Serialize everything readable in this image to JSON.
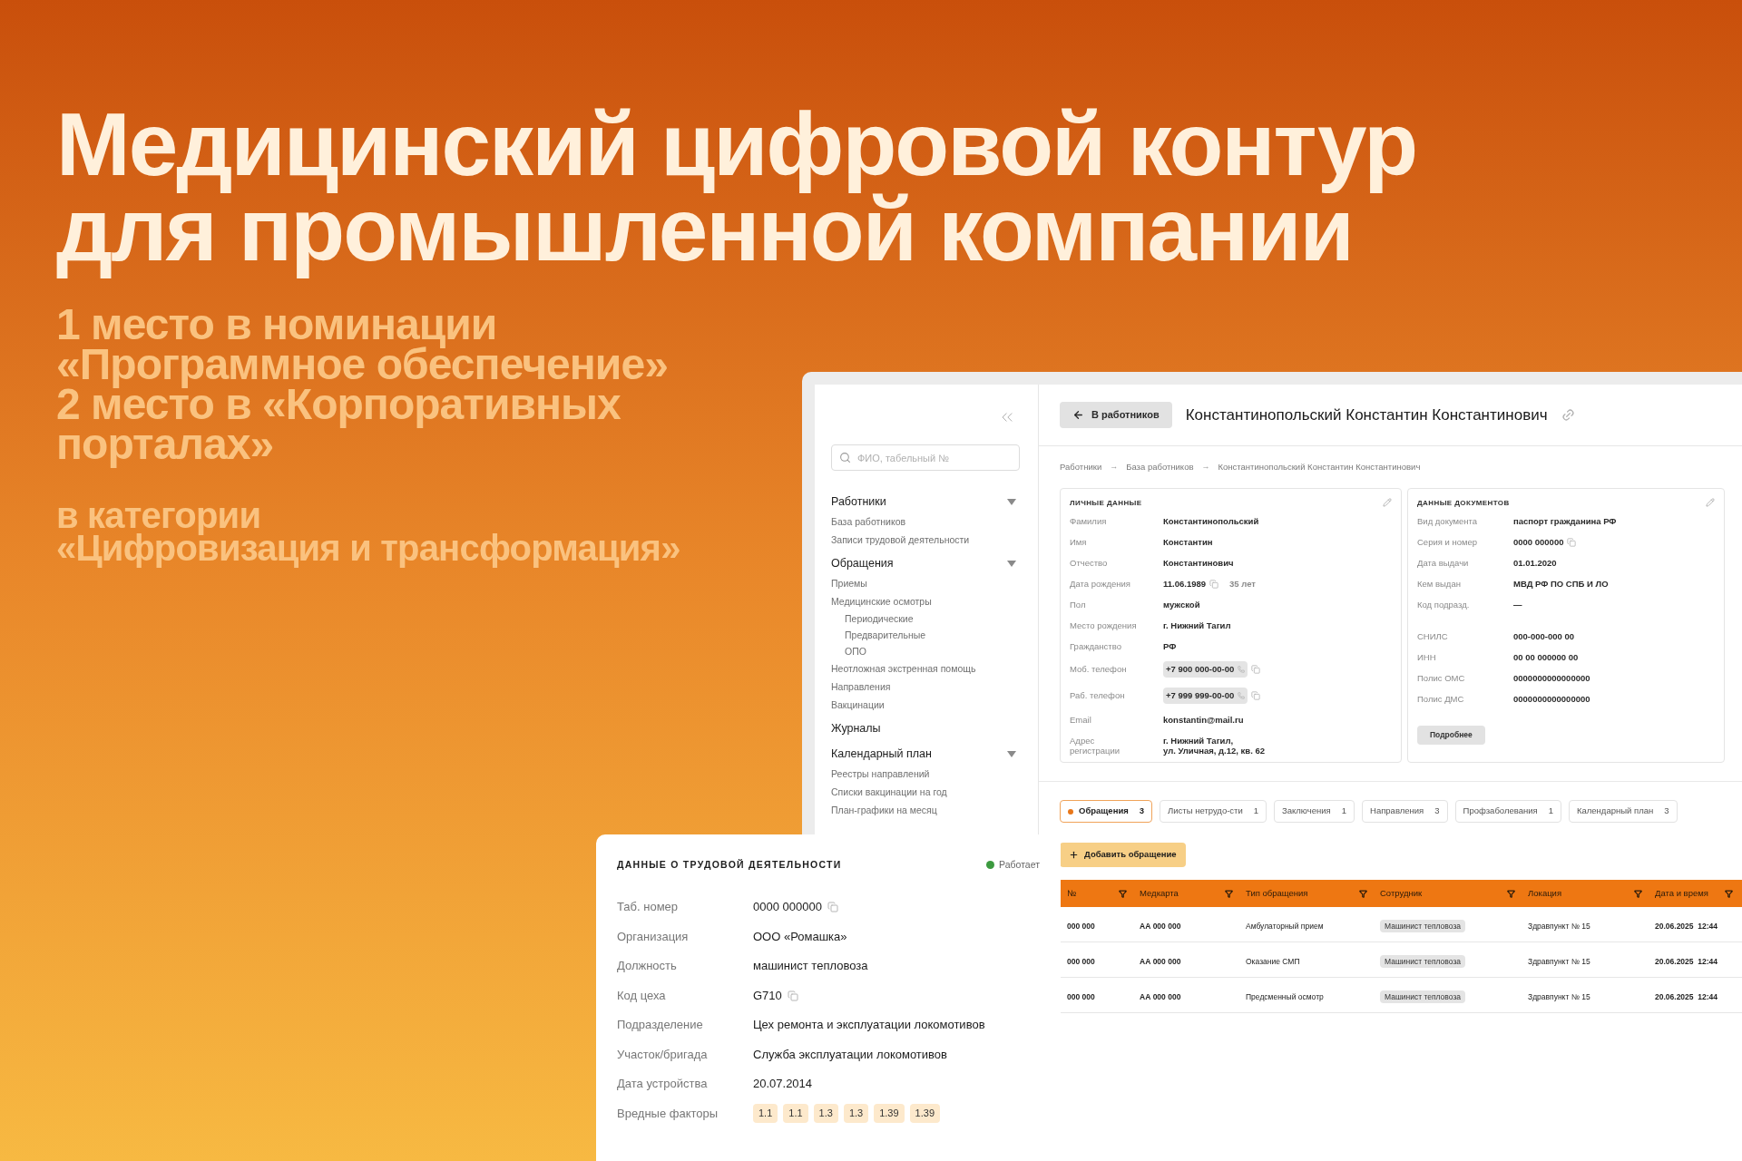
{
  "headline": [
    "Медицинский цифровой контур",
    "для промышленной компании"
  ],
  "awards": [
    "1 место в номинации",
    "«Программное обеспечение»",
    "2 место в «Корпоративных",
    "порталах»"
  ],
  "category": [
    "в категории",
    "«Цифровизация и трансформация»"
  ],
  "sidebar": {
    "search_placeholder": "ФИО, табельный №",
    "sections": [
      {
        "title": "Работники",
        "kind": "group",
        "expanded": true,
        "items": [
          {
            "label": "База работников"
          },
          {
            "label": "Записи трудовой деятельности"
          }
        ]
      },
      {
        "title": "Обращения",
        "kind": "group",
        "expanded": true,
        "items": [
          {
            "label": "Приемы"
          },
          {
            "label": "Медицинские осмотры",
            "children": [
              {
                "label": "Периодические"
              },
              {
                "label": "Предварительные"
              },
              {
                "label": "ОПО"
              }
            ]
          },
          {
            "label": "Неотложная экстренная помощь"
          },
          {
            "label": "Направления"
          },
          {
            "label": "Вакцинации"
          }
        ]
      },
      {
        "title": "Журналы",
        "kind": "link"
      },
      {
        "title": "Календарный план",
        "kind": "group",
        "expanded": true,
        "items": [
          {
            "label": "Реестры направлений"
          },
          {
            "label": "Списки вакцинации на год"
          },
          {
            "label": "План-графики на месяц"
          }
        ]
      }
    ]
  },
  "header": {
    "back_button": "В работников",
    "title": "Константинопольский Константин Константинович"
  },
  "breadcrumbs": {
    "separator": "→",
    "items": [
      "Работники",
      "База работников",
      "Константинопольский Константин Константинович"
    ]
  },
  "personal_card": {
    "title": "ЛИЧНЫЕ ДАННЫЕ",
    "rows": [
      {
        "kind": "text",
        "label": "Фамилия",
        "value": "Константинопольский"
      },
      {
        "kind": "text",
        "label": "Имя",
        "value": "Константин"
      },
      {
        "kind": "text",
        "label": "Отчество",
        "value": "Константинович"
      },
      {
        "kind": "date",
        "label": "Дата рождения",
        "value": "11.06.1989",
        "extra": "35 лет"
      },
      {
        "kind": "text",
        "label": "Пол",
        "value": "мужской"
      },
      {
        "kind": "text",
        "label": "Место рождения",
        "value": "г. Нижний Тагил"
      },
      {
        "kind": "text",
        "label": "Гражданство",
        "value": "РФ"
      },
      {
        "kind": "phone",
        "label": "Моб. телефон",
        "value": "+7 900 000-00-00"
      },
      {
        "kind": "phone",
        "label": "Раб. телефон",
        "value": "+7 999 999-00-00"
      },
      {
        "kind": "text",
        "label": "Email",
        "value": "konstantin@mail.ru"
      },
      {
        "kind": "text",
        "label": "Адрес\nрегистрации",
        "value": "г. Нижний Тагил,\nул. Уличная, д.12, кв. 62"
      }
    ]
  },
  "documents_card": {
    "title": "ДАННЫЕ ДОКУМЕНТОВ",
    "groups": [
      [
        {
          "kind": "text",
          "label": "Вид документа",
          "value": "паспорт гражданина РФ"
        },
        {
          "kind": "copy",
          "label": "Серия и номер",
          "value": "0000 000000"
        },
        {
          "kind": "text",
          "label": "Дата выдачи",
          "value": "01.01.2020"
        },
        {
          "kind": "text",
          "label": "Кем выдан",
          "value": "МВД РФ ПО СПБ И ЛО"
        },
        {
          "kind": "text",
          "label": "Код подразд.",
          "value": "—"
        }
      ],
      [
        {
          "kind": "text",
          "label": "СНИЛС",
          "value": "000-000-000 00"
        },
        {
          "kind": "text",
          "label": "ИНН",
          "value": "00 00 000000 00"
        },
        {
          "kind": "text",
          "label": "Полис ОМС",
          "value": "0000000000000000"
        },
        {
          "kind": "text",
          "label": "Полис ДМС",
          "value": "0000000000000000"
        }
      ]
    ],
    "button": "Подробнее"
  },
  "tabs": [
    {
      "label": "Обращения",
      "count": "3",
      "selected": true
    },
    {
      "label": "Листы нетрудо-сти",
      "count": "1",
      "selected": false
    },
    {
      "label": "Заключения",
      "count": "1",
      "selected": false
    },
    {
      "label": "Направления",
      "count": "3",
      "selected": false
    },
    {
      "label": "Профзаболевания",
      "count": "1",
      "selected": false
    },
    {
      "label": "Календарный план",
      "count": "3",
      "selected": false
    }
  ],
  "add_button": "Добавить обращение",
  "table": {
    "columns": [
      {
        "label": "№",
        "kind": "text"
      },
      {
        "label": "Медкарта",
        "kind": "text"
      },
      {
        "label": "Тип обращения",
        "kind": "text"
      },
      {
        "label": "Сотрудник",
        "kind": "tag"
      },
      {
        "label": "Локация",
        "kind": "text"
      },
      {
        "label": "Дата и время",
        "kind": "bold"
      }
    ],
    "rows": [
      [
        "000 000",
        "АА 000 000",
        "Амбулаторный прием",
        "Машинист тепловоза",
        "Здравпункт № 15",
        "20.06.2025  12:44"
      ],
      [
        "000 000",
        "АА 000 000",
        "Оказание СМП",
        "Машинист тепловоза",
        "Здравпункт № 15",
        "20.06.2025  12:44"
      ],
      [
        "000 000",
        "АА 000 000",
        "Предсменный осмотр",
        "Машинист тепловоза",
        "Здравпункт № 15",
        "20.06.2025  12:44"
      ]
    ]
  },
  "work_card": {
    "title": "ДАННЫЕ О ТРУДОВОЙ ДЕЯТЕЛЬНОСТИ",
    "status": {
      "label": "Работает",
      "color": "#3c9a3f"
    },
    "rows": [
      {
        "kind": "copy",
        "label": "Таб. номер",
        "value": "0000 000000"
      },
      {
        "kind": "text",
        "label": "Организация",
        "value": "ООО «Ромашка»"
      },
      {
        "kind": "text",
        "label": "Должность",
        "value": "машинист тепловоза"
      },
      {
        "kind": "copy",
        "label": "Код цеха",
        "value": "G710"
      },
      {
        "kind": "text",
        "label": "Подразделение",
        "value": "Цех ремонта и эксплуатации локомотивов"
      },
      {
        "kind": "text",
        "label": "Участок/бригада",
        "value": "Служба эксплуатации локомотивов"
      },
      {
        "kind": "text",
        "label": "Дата устройства",
        "value": "20.07.2014"
      },
      {
        "kind": "tags",
        "label": "Вредные факторы",
        "tags": [
          "1.1",
          "1.1",
          "1.3",
          "1.3",
          "1.39",
          "1.39"
        ]
      }
    ]
  }
}
